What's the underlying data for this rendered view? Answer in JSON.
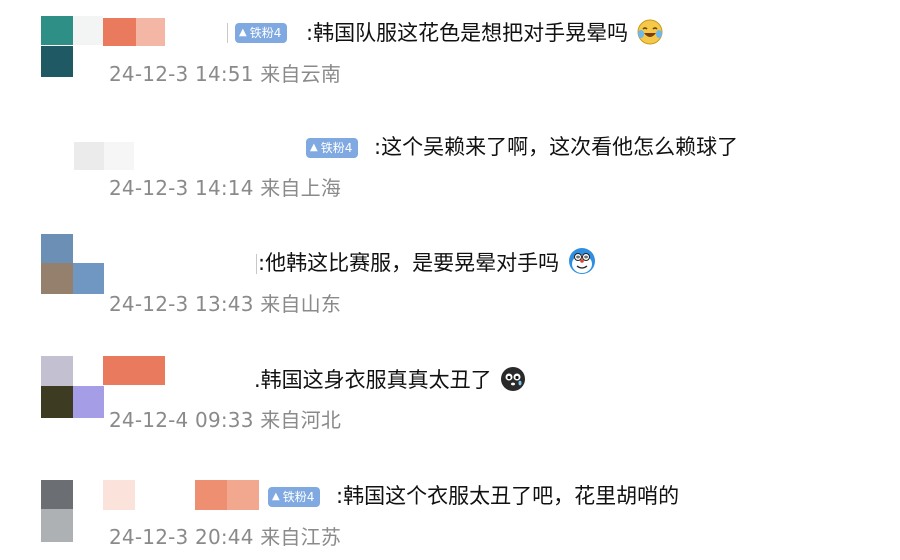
{
  "comments": [
    {
      "badge": "铁粉4",
      "text": ":韩国队服这花色是想把对手晃晕吗",
      "time": "24-12-3 14:51",
      "location": "来自云南",
      "emoji": "laughing-tears-emoji"
    },
    {
      "badge": "铁粉4",
      "text": ":这个吴赖来了啊，这次看他怎么赖球了",
      "time": "24-12-3 14:14",
      "location": "来自上海",
      "emoji": ""
    },
    {
      "badge": "",
      "text": ":他韩这比赛服，是要晃晕对手吗",
      "time": "24-12-3 13:43",
      "location": "来自山东",
      "emoji": "dizzy-doraemon-emoji"
    },
    {
      "badge": "",
      "text": ".韩国这身衣服真真太丑了",
      "time": "24-12-4 09:33",
      "location": "来自河北",
      "emoji": "crying-dark-face-emoji"
    },
    {
      "badge": "铁粉4",
      "text": ":韩国这个衣服太丑了吧，花里胡哨的",
      "time": "24-12-3 20:44",
      "location": "来自江苏",
      "emoji": ""
    }
  ],
  "colors": {
    "badge_bg": "#7fa9e0",
    "text": "#111111",
    "meta": "#8a8a8a"
  }
}
